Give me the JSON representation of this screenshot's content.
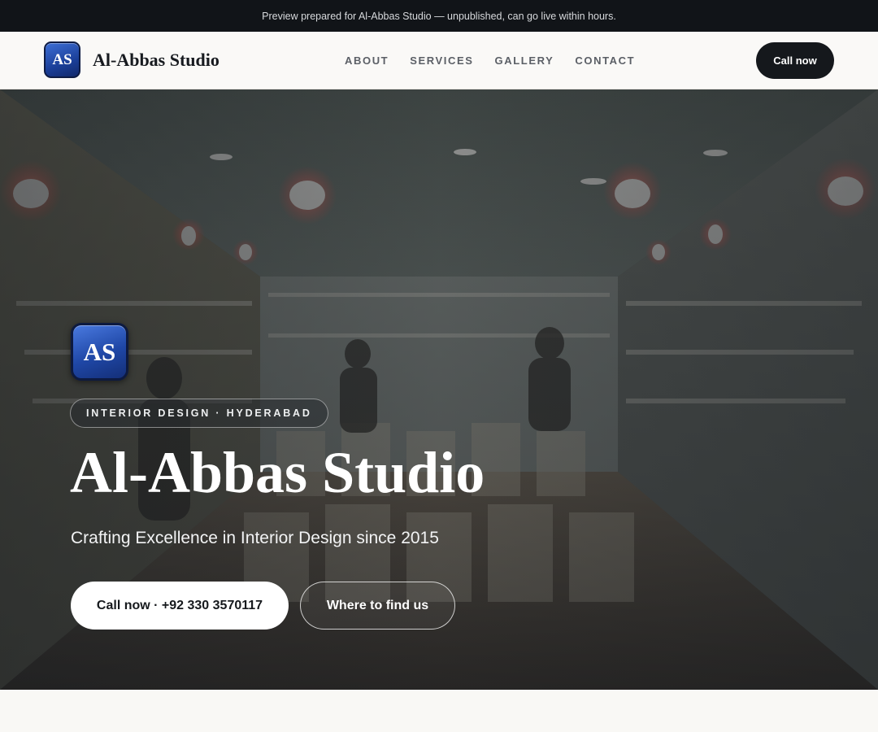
{
  "banner": {
    "text": "Preview prepared for Al-Abbas Studio — unpublished, can go live within hours."
  },
  "header": {
    "logo_text": "AS",
    "brand_name": "Al-Abbas Studio",
    "nav": [
      {
        "label": "ABOUT"
      },
      {
        "label": "SERVICES"
      },
      {
        "label": "GALLERY"
      },
      {
        "label": "CONTACT"
      }
    ],
    "call_label": "Call now"
  },
  "hero": {
    "logo_text": "AS",
    "tag": "INTERIOR DESIGN · HYDERABAD",
    "title": "Al-Abbas Studio",
    "subtitle": "Crafting Excellence in Interior Design since 2015",
    "primary_cta": "Call now · +92 330 3570117",
    "secondary_cta": "Where to find us",
    "background_image": "interior-shop-photo"
  },
  "colors": {
    "topbar": "#111418",
    "page_bg": "#f9f8f5",
    "dark_button": "#15181c",
    "logo_blue": "#1f47a6"
  }
}
